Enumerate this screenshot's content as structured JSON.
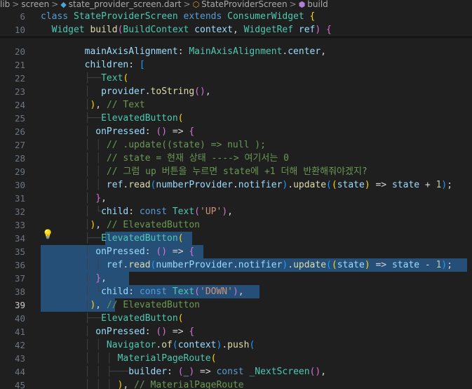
{
  "breadcrumb": {
    "items": [
      "lib",
      "screen",
      "state_provider_screen.dart",
      "StateProviderScreen",
      "build"
    ],
    "separator": ">"
  },
  "editor": {
    "active_line": 39,
    "sticky_lines": [
      {
        "number": "6",
        "tokens": [
          [
            "kw",
            "class "
          ],
          [
            "ty",
            "StateProviderScreen "
          ],
          [
            "kw",
            "extends "
          ],
          [
            "ty",
            "ConsumerWidget "
          ],
          [
            "b1",
            "{"
          ]
        ]
      },
      {
        "number": "10",
        "tokens": [
          [
            "ty",
            "  Widget "
          ],
          [
            "fn",
            "build"
          ],
          [
            "b2",
            "("
          ],
          [
            "ty",
            "BuildContext "
          ],
          [
            "va",
            "context"
          ],
          [
            "pu",
            ", "
          ],
          [
            "ty",
            "WidgetRef "
          ],
          [
            "va",
            "ref"
          ],
          [
            "b2",
            ")"
          ],
          [
            "pu",
            " "
          ],
          [
            "b2",
            "{"
          ]
        ]
      }
    ],
    "lines": [
      {
        "number": "20",
        "tokens": [
          [
            "guide",
            "        "
          ],
          [
            "va",
            "mainAxisAlignment"
          ],
          [
            "pu",
            ": "
          ],
          [
            "ty",
            "MainAxisAlignment"
          ],
          [
            "pu",
            "."
          ],
          [
            "va",
            "center"
          ],
          [
            "pu",
            ","
          ]
        ]
      },
      {
        "number": "21",
        "tokens": [
          [
            "guide",
            "        "
          ],
          [
            "va",
            "children"
          ],
          [
            "pu",
            ": "
          ],
          [
            "b3",
            "["
          ]
        ]
      },
      {
        "number": "22",
        "tokens": [
          [
            "guide",
            "        ├──"
          ],
          [
            "ty",
            "Text"
          ],
          [
            "b1",
            "("
          ]
        ]
      },
      {
        "number": "23",
        "tokens": [
          [
            "guide",
            "        │  "
          ],
          [
            "va",
            "provider"
          ],
          [
            "pu",
            "."
          ],
          [
            "fn",
            "toString"
          ],
          [
            "b2",
            "()"
          ],
          [
            "pu",
            ","
          ]
        ]
      },
      {
        "number": "24",
        "tokens": [
          [
            "guide",
            "        │"
          ],
          [
            "b1",
            ")"
          ],
          [
            "pu",
            ", "
          ],
          [
            "cm",
            "// Text"
          ]
        ]
      },
      {
        "number": "25",
        "tokens": [
          [
            "guide",
            "        ├──"
          ],
          [
            "ty",
            "ElevatedButton"
          ],
          [
            "b1",
            "("
          ]
        ]
      },
      {
        "number": "26",
        "tokens": [
          [
            "guide",
            "        │ "
          ],
          [
            "va",
            "onPressed"
          ],
          [
            "pu",
            ": "
          ],
          [
            "b2",
            "()"
          ],
          [
            "pu",
            " => "
          ],
          [
            "b2",
            "{"
          ]
        ]
      },
      {
        "number": "27",
        "tokens": [
          [
            "guide",
            "        │ │ "
          ],
          [
            "cm",
            "// .update((state) => null );"
          ]
        ]
      },
      {
        "number": "28",
        "tokens": [
          [
            "guide",
            "        │ │ "
          ],
          [
            "cm",
            "// state = 현재 상태 ----> 여기서는 0"
          ]
        ]
      },
      {
        "number": "29",
        "tokens": [
          [
            "guide",
            "        │ │ "
          ],
          [
            "cm",
            "// 그럼 up 버튼을 누르면 state에 +1 더해 반환해줘야겠지?"
          ]
        ]
      },
      {
        "number": "30",
        "tokens": [
          [
            "guide",
            "        │ │ "
          ],
          [
            "va",
            "ref"
          ],
          [
            "pu",
            "."
          ],
          [
            "fn",
            "read"
          ],
          [
            "b3",
            "("
          ],
          [
            "va",
            "numberProvider"
          ],
          [
            "pu",
            "."
          ],
          [
            "va",
            "notifier"
          ],
          [
            "b3",
            ")"
          ],
          [
            "pu",
            "."
          ],
          [
            "fn",
            "update"
          ],
          [
            "b3",
            "("
          ],
          [
            "b1",
            "("
          ],
          [
            "va",
            "state"
          ],
          [
            "b1",
            ")"
          ],
          [
            "pu",
            " => "
          ],
          [
            "va",
            "state"
          ],
          [
            "pu",
            " + "
          ],
          [
            "nu",
            "1"
          ],
          [
            "b3",
            ")"
          ],
          [
            "pu",
            ";"
          ]
        ]
      },
      {
        "number": "31",
        "tokens": [
          [
            "guide",
            "        │ "
          ],
          [
            "b2",
            "}"
          ],
          [
            "pu",
            ","
          ]
        ]
      },
      {
        "number": "32",
        "tokens": [
          [
            "guide",
            "        │ └"
          ],
          [
            "va",
            "child"
          ],
          [
            "pu",
            ": "
          ],
          [
            "kw",
            "const "
          ],
          [
            "ty",
            "Text"
          ],
          [
            "b2",
            "("
          ],
          [
            "st",
            "'UP'"
          ],
          [
            "b2",
            ")"
          ],
          [
            "pu",
            ","
          ]
        ]
      },
      {
        "number": "33",
        "tokens": [
          [
            "guide",
            "        │"
          ],
          [
            "b1",
            ")"
          ],
          [
            "pu",
            ", "
          ],
          [
            "cm",
            "// ElevatedButton"
          ]
        ]
      },
      {
        "number": "34",
        "tokens": [
          [
            "guide",
            "        ├──"
          ],
          [
            "ty",
            "ElevatedButton"
          ],
          [
            "b1",
            "("
          ]
        ]
      },
      {
        "number": "35",
        "tokens": [
          [
            "guide",
            "        │ "
          ],
          [
            "va",
            "onPressed"
          ],
          [
            "pu",
            ": "
          ],
          [
            "b2",
            "()"
          ],
          [
            "pu",
            " => "
          ],
          [
            "b2",
            "{"
          ]
        ]
      },
      {
        "number": "36",
        "tokens": [
          [
            "guide",
            "        │ │ "
          ],
          [
            "va",
            "ref"
          ],
          [
            "pu",
            "."
          ],
          [
            "fn",
            "read"
          ],
          [
            "b3",
            "("
          ],
          [
            "va",
            "numberProvider"
          ],
          [
            "pu",
            "."
          ],
          [
            "va",
            "notifier"
          ],
          [
            "b3",
            ")"
          ],
          [
            "pu",
            "."
          ],
          [
            "fn",
            "update"
          ],
          [
            "b3",
            "("
          ],
          [
            "b1",
            "("
          ],
          [
            "va",
            "state"
          ],
          [
            "b1",
            ")"
          ],
          [
            "pu",
            " => "
          ],
          [
            "va",
            "state"
          ],
          [
            "pu",
            " - "
          ],
          [
            "nu",
            "1"
          ],
          [
            "b3",
            ")"
          ],
          [
            "pu",
            ";"
          ]
        ]
      },
      {
        "number": "37",
        "tokens": [
          [
            "guide",
            "        │ "
          ],
          [
            "b2",
            "}"
          ],
          [
            "pu",
            ","
          ]
        ]
      },
      {
        "number": "38",
        "tokens": [
          [
            "guide",
            "        │ └"
          ],
          [
            "va",
            "child"
          ],
          [
            "pu",
            ": "
          ],
          [
            "kw",
            "const "
          ],
          [
            "ty",
            "Text"
          ],
          [
            "b2",
            "("
          ],
          [
            "st",
            "'DOWN'"
          ],
          [
            "b2",
            ")"
          ],
          [
            "pu",
            ","
          ]
        ]
      },
      {
        "number": "39",
        "tokens": [
          [
            "guide",
            "        │"
          ],
          [
            "b1",
            ")"
          ],
          [
            "pu",
            ", "
          ],
          [
            "cm",
            "// ElevatedButton"
          ]
        ]
      },
      {
        "number": "40",
        "tokens": [
          [
            "guide",
            "        ├──"
          ],
          [
            "ty",
            "ElevatedButton"
          ],
          [
            "b1",
            "("
          ]
        ]
      },
      {
        "number": "41",
        "tokens": [
          [
            "guide",
            "        │ "
          ],
          [
            "va",
            "onPressed"
          ],
          [
            "pu",
            ": "
          ],
          [
            "b2",
            "()"
          ],
          [
            "pu",
            " => "
          ],
          [
            "b2",
            "{"
          ]
        ]
      },
      {
        "number": "42",
        "tokens": [
          [
            "guide",
            "        │ │ "
          ],
          [
            "ty",
            "Navigator"
          ],
          [
            "pu",
            "."
          ],
          [
            "fn",
            "of"
          ],
          [
            "b3",
            "("
          ],
          [
            "va",
            "context"
          ],
          [
            "b3",
            ")"
          ],
          [
            "pu",
            "."
          ],
          [
            "fn",
            "push"
          ],
          [
            "b3",
            "("
          ]
        ]
      },
      {
        "number": "43",
        "tokens": [
          [
            "guide",
            "        │ │ │ "
          ],
          [
            "ty",
            "MaterialPageRoute"
          ],
          [
            "b1",
            "("
          ]
        ]
      },
      {
        "number": "44",
        "tokens": [
          [
            "guide",
            "        │ │ ├───"
          ],
          [
            "va",
            "builder"
          ],
          [
            "pu",
            ": "
          ],
          [
            "b2",
            "("
          ],
          [
            "va",
            "_"
          ],
          [
            "b2",
            ")"
          ],
          [
            "pu",
            " => "
          ],
          [
            "kw",
            "const "
          ],
          [
            "ty",
            "_NextScreen"
          ],
          [
            "b2",
            "()"
          ],
          [
            "pu",
            ","
          ]
        ]
      },
      {
        "number": "45",
        "tokens": [
          [
            "guide",
            "        │ │ │ "
          ],
          [
            "b1",
            ")"
          ],
          [
            "pu",
            ", "
          ],
          [
            "cm",
            "// MaterialPageRoute"
          ]
        ]
      }
    ]
  }
}
